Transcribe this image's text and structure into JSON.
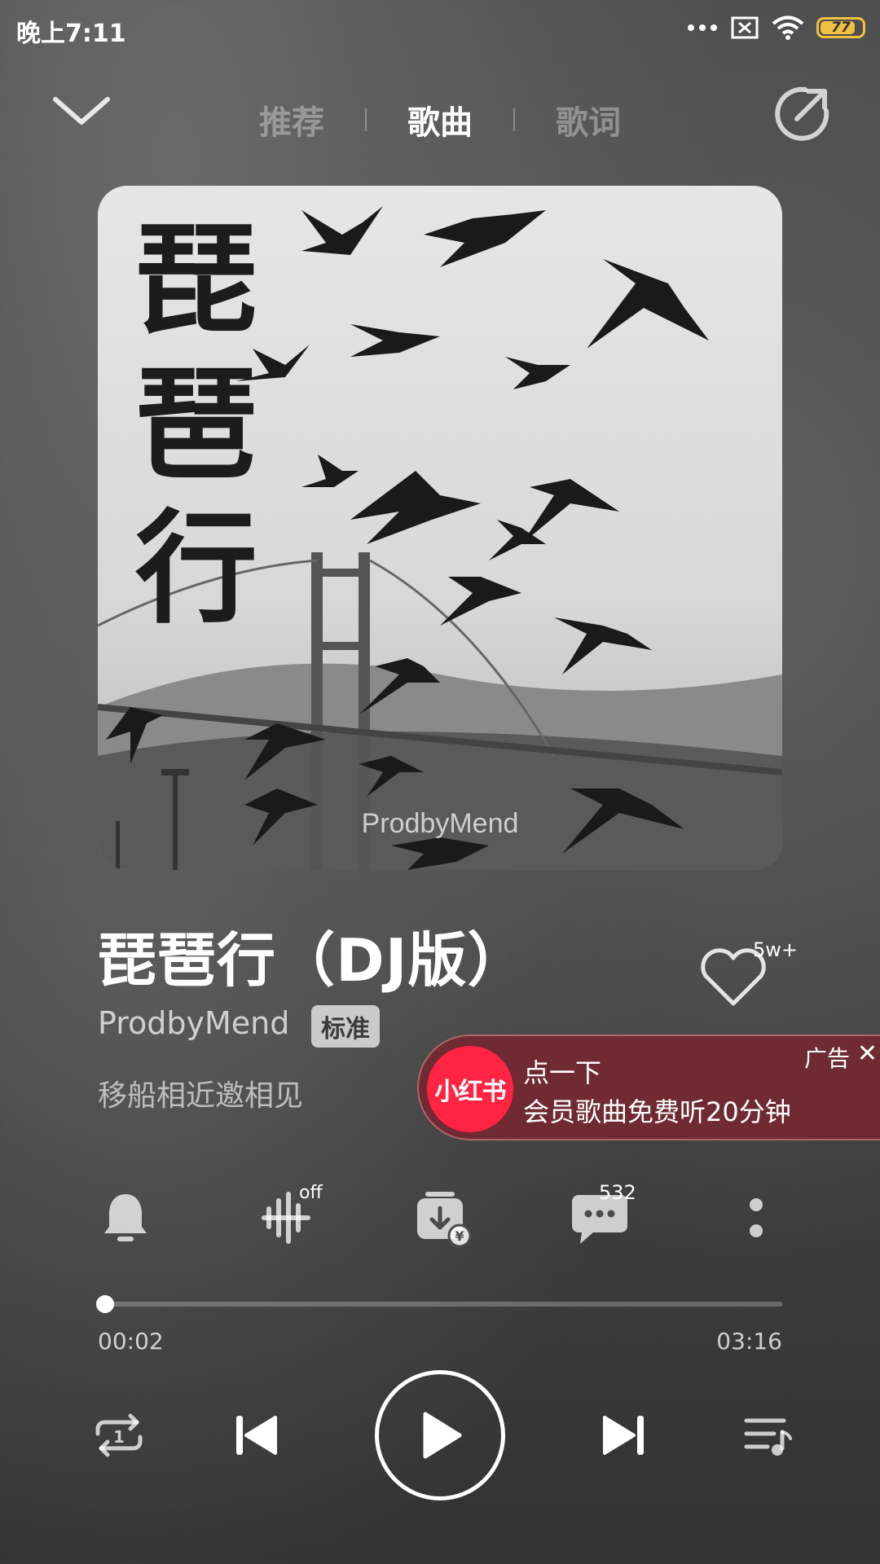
{
  "status_bar": {
    "time": "晚上7:11",
    "battery": "77",
    "icons": [
      "more-dots-icon",
      "sim-x-icon",
      "wifi-icon",
      "battery-icon"
    ]
  },
  "header": {
    "tabs": [
      {
        "label": "推荐",
        "active": false
      },
      {
        "label": "歌曲",
        "active": true
      },
      {
        "label": "歌词",
        "active": false
      }
    ]
  },
  "album_art": {
    "vertical_title": "琵琶行",
    "watermark": "ProdbyMend"
  },
  "song": {
    "title": "琵琶行（DJ版）",
    "artist": "ProdbyMend",
    "quality": "标准",
    "lyric": "移船相近邀相见",
    "like_count": "5w+"
  },
  "ad": {
    "logo_text": "小红书",
    "line1": "点一下",
    "line2": "会员歌曲免费听20分钟",
    "tag": "广告",
    "close": "✕"
  },
  "actions": {
    "effect_state": "off",
    "comment_count": "532"
  },
  "player": {
    "current_time": "00:02",
    "total_time": "03:16",
    "progress": 0.0102
  },
  "colors": {
    "ad_background": "#6f2a32",
    "ad_logo": "#ff2442",
    "battery": "#f0c040"
  }
}
